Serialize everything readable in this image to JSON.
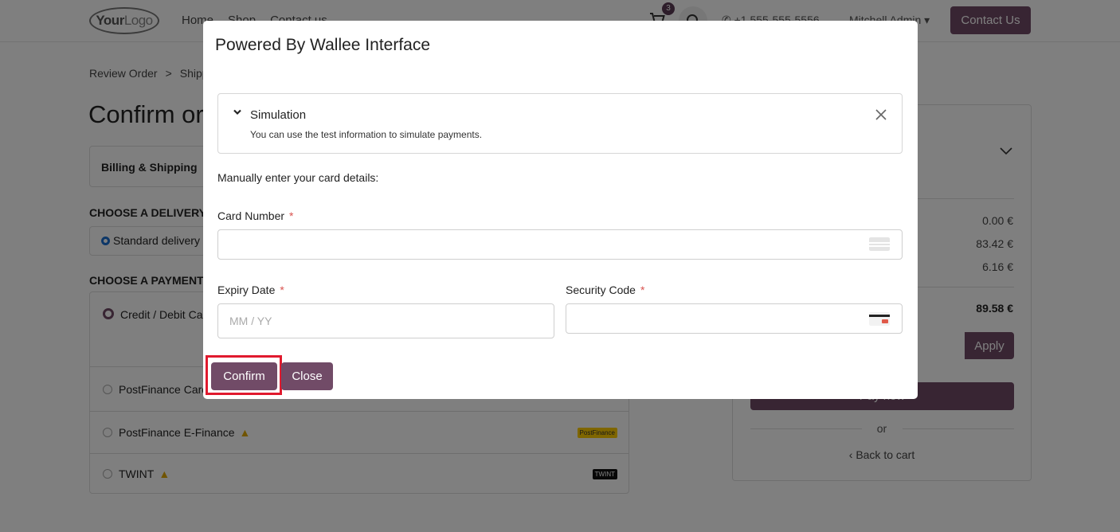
{
  "nav": {
    "logo_your": "Your",
    "logo_logo": "Logo",
    "links": [
      "Home",
      "Shop",
      "Contact us"
    ],
    "cart_count": "3",
    "phone": "+1 555-555-5556",
    "user": "Mitchell Admin",
    "contact_btn": "Contact Us"
  },
  "breadcrumb": [
    "Review Order",
    ">",
    "Shipping"
  ],
  "page_title": "Confirm order",
  "billing_label": "Billing & Shipping",
  "delivery": {
    "section_label": "CHOOSE A DELIVERY METHOD",
    "option": "Standard delivery"
  },
  "payment": {
    "section_label": "CHOOSE A PAYMENT METHOD",
    "options": [
      {
        "label": "Credit / Debit Card"
      },
      {
        "label": "PostFinance Card"
      },
      {
        "label": "PostFinance E-Finance",
        "logo": "PostFinance"
      },
      {
        "label": "TWINT",
        "logo": "TWINT"
      }
    ]
  },
  "summary": {
    "values": [
      "0.00 €",
      "83.42 €",
      "6.16 €"
    ],
    "total": "89.58 €",
    "apply": "Apply",
    "pay_now": "Pay now",
    "or": "or",
    "back_to_cart": "Back to cart"
  },
  "modal": {
    "title": "Powered By Wallee Interface",
    "simulation_title": "Simulation",
    "simulation_desc": "You can use the test information to simulate payments.",
    "manual_text": "Manually enter your card details:",
    "card_number_label": "Card Number",
    "card_number_value": "",
    "expiry_label": "Expiry Date",
    "expiry_placeholder": "MM / YY",
    "security_label": "Security Code",
    "security_value": "",
    "required_mark": "*",
    "confirm": "Confirm",
    "close": "Close"
  },
  "colors": {
    "brand": "#714b67",
    "highlight": "#e01a2e",
    "required": "#d9534f"
  }
}
